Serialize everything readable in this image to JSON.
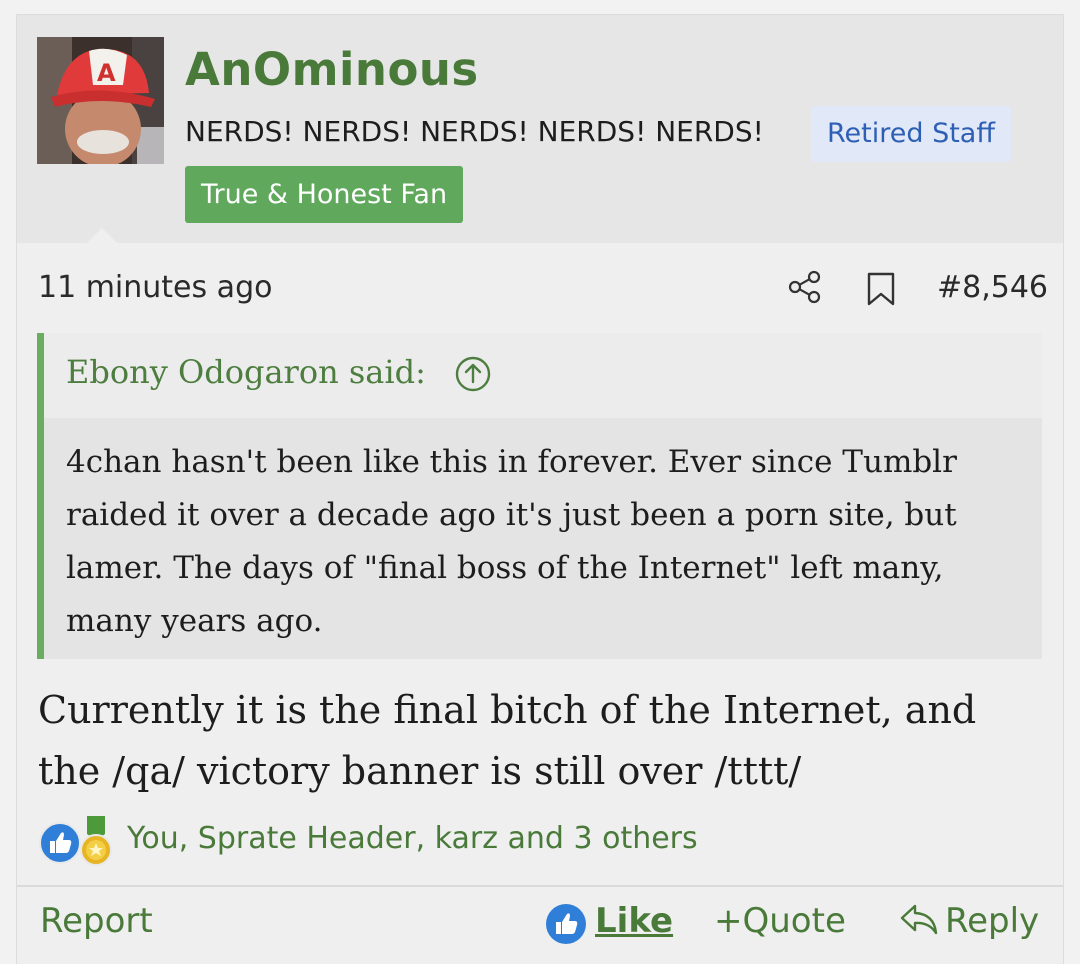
{
  "post": {
    "author": {
      "username": "AnOminous",
      "title": "NERDS! NERDS! NERDS! NERDS! NERDS!",
      "badges": [
        "Retired Staff",
        "True & Honest Fan"
      ]
    },
    "timestamp": "11 minutes ago",
    "post_number": "#8,546",
    "icons": {
      "share": "share-icon",
      "bookmark": "bookmark-icon"
    },
    "quote": {
      "author_label": "Ebony Odogaron said:",
      "text": "4chan hasn't been like this in forever. Ever since Tumblr raided it over a decade ago it's just been a porn site, but lamer. The days of \"final boss of the Internet\" left many, many years ago."
    },
    "message": "Currently it is the final bitch of the Internet, and the /qa/ victory banner is still over /tttt/",
    "reactions": {
      "icons": [
        "like-icon",
        "medal-icon"
      ],
      "users_text": "You, Sprate Header, karz and 3 others"
    },
    "actions": {
      "report": "Report",
      "like": "Like",
      "quote": "Quote",
      "quote_prefix": "+",
      "reply": "Reply"
    },
    "colors": {
      "accent_green": "#4a7a3a",
      "badge_blue_bg": "#e1e8f7",
      "badge_blue_text": "#2d5fb4",
      "badge_green_bg": "#5fa85c",
      "quote_border": "#6aad61",
      "like_blue": "#2f7fd9"
    }
  }
}
